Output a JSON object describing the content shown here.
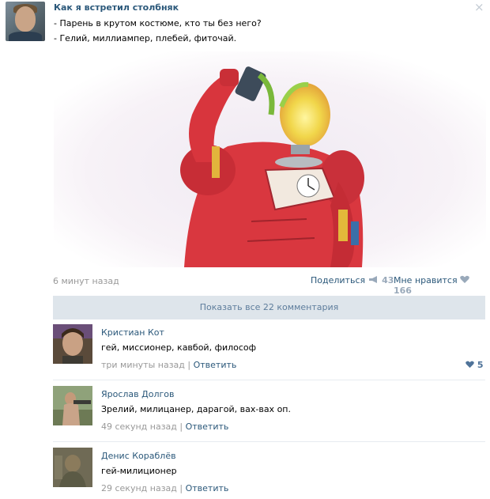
{
  "post": {
    "title": "Как я встретил столбняк",
    "lines": [
      "- Парень в крутом костюме, кто ты без него?",
      "- Гелий, миллиампер, плебей, фиточай."
    ],
    "time": "6 минут назад",
    "share_label": "Поделиться",
    "share_count": "43",
    "like_label": "Мне нравится",
    "like_count": "166",
    "close_icon": "×"
  },
  "comments_bar": {
    "label": "Показать все 22 комментария"
  },
  "comments": [
    {
      "name": "Кристиан Кот",
      "text": "гей, миссионер, кавбой, философ",
      "time": "три минуты назад",
      "reply": "Ответить",
      "likes": "5"
    },
    {
      "name": "Ярослав Долгов",
      "text": "Зрелий, милицанер, дарагой, вах-вах оп.",
      "time": "49 секунд назад",
      "reply": "Ответить"
    },
    {
      "name": "Денис Кораблёв",
      "text": "гей-милиционер",
      "time": "29 секунд назад",
      "reply": "Ответить"
    }
  ],
  "colors": {
    "link": "#2b587a",
    "muted": "#999999",
    "bar": "#dee5eb",
    "accent_red": "#d9373f"
  }
}
